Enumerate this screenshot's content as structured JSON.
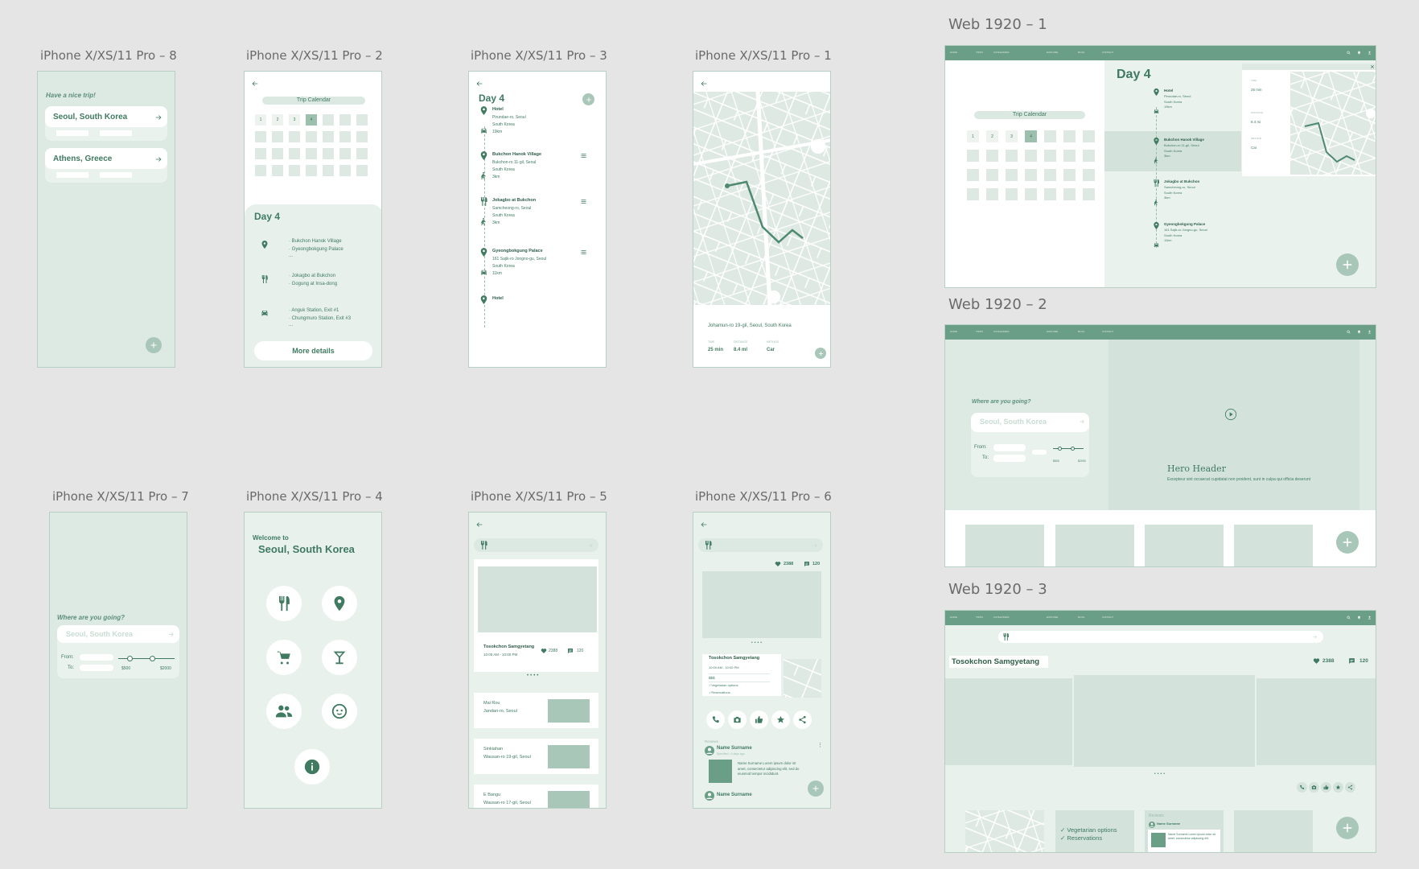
{
  "frames": {
    "f8": "iPhone X/XS/11 Pro – 8",
    "f2": "iPhone X/XS/11 Pro – 2",
    "f3": "iPhone X/XS/11 Pro – 3",
    "f1": "iPhone X/XS/11 Pro – 1",
    "f7": "iPhone X/XS/11 Pro – 7",
    "f4": "iPhone X/XS/11 Pro – 4",
    "f5": "iPhone X/XS/11 Pro – 5",
    "f6": "iPhone X/XS/11 Pro – 6",
    "w1": "Web 1920 – 1",
    "w2": "Web 1920 – 2",
    "w3": "Web 1920 – 3"
  },
  "icons": {
    "back": "arrow-left-icon",
    "add": "plus-icon",
    "pin": "map-pin-icon",
    "food": "fork-knife-icon",
    "car": "car-icon",
    "walk": "walking-icon",
    "menu": "hamburger-icon",
    "cart": "shopping-cart-icon",
    "drink": "cocktail-icon",
    "people": "people-icon",
    "baby": "baby-face-icon",
    "info": "info-icon",
    "heart": "heart-icon",
    "comment": "comment-icon",
    "phone": "phone-icon",
    "camera": "camera-icon",
    "like": "thumbs-up-icon",
    "star": "star-icon",
    "share": "share-icon",
    "play": "play-icon",
    "search": "search-icon",
    "bell": "bell-icon",
    "user": "user-icon",
    "close": "close-icon",
    "avatar": "avatar-icon"
  },
  "colors": {
    "brand": "#6a9e86",
    "mint": "#dde9e3",
    "accent": "#3f7a61"
  },
  "s8": {
    "greeting": "Have a nice trip!",
    "trips": [
      "Seoul, South Korea",
      "Athens, Greece"
    ]
  },
  "s2": {
    "calendar_title": "Trip Calendar",
    "days": [
      "1",
      "2",
      "3",
      "4"
    ],
    "day": "Day 4",
    "groups": [
      [
        "· Bukchon Hanok Village",
        "· Gyeongbokgung Palace",
        "..."
      ],
      [
        "· Jokagbo at Bukchon",
        "· Gogung at Insa-dong"
      ],
      [
        "· Anguk Station, Exit #1",
        "· Chungmuro Station, Exit #3",
        "..."
      ]
    ],
    "more": "More details"
  },
  "s3": {
    "day": "Day 4",
    "stops": [
      {
        "name": "Hotel",
        "lines": [
          "Pirundae-ro, Seoul",
          "South Korea",
          "19km"
        ]
      },
      {
        "name": "Bukchon Hanok Village",
        "lines": [
          "Bukchon-ro 11-gil, Seoul",
          "South Korea",
          "3km"
        ]
      },
      {
        "name": "Jokagbo at Bukchon",
        "lines": [
          "Samcheong-ro, Seoul",
          "South Korea",
          "3km"
        ]
      },
      {
        "name": "Gyeongbokgung Palace",
        "lines": [
          "161 Sajik-ro Jongno-gu, Seoul",
          "South Korea",
          "11km"
        ]
      },
      {
        "name": "Hotel",
        "lines": []
      }
    ]
  },
  "s1": {
    "address": "Johamun-ro 19-gil, Seoul, South Korea",
    "stats": [
      {
        "label": "TIME",
        "value": "25 min"
      },
      {
        "label": "DISTANCE",
        "value": "8.4 ml"
      },
      {
        "label": "METHOD",
        "value": "Car"
      }
    ]
  },
  "s7": {
    "question": "Where are you going?",
    "placeholder": "Seoul, South Korea",
    "from": "From:",
    "to": "To:",
    "price_min": "$500",
    "price_max": "$2000",
    "range_low": 0.2,
    "range_high": 0.6
  },
  "s4": {
    "welcome": "Welcome to",
    "city": "Seoul, South Korea"
  },
  "s5": {
    "place": "Tosokchon Samgyetang",
    "hours": "10:00 AM - 10:00 PM",
    "likes": "2388",
    "comments": "120",
    "list": [
      {
        "name": "Mai Rou",
        "addr": "Jandari-ro, Seoul"
      },
      {
        "name": "Sinkiahan",
        "addr": "Wausan-ro 19-gil, Seoul"
      },
      {
        "name": "E Bangu",
        "addr": "Wausan-ro 17-gil, Seoul"
      }
    ]
  },
  "s6": {
    "likes": "2388",
    "comments": "120",
    "place": "Tosokchon Samgyetang",
    "hours": "10:00 AM - 10:00 PM",
    "price": "$$$",
    "features": [
      "✓Vegetarian options",
      "✓Reservations"
    ],
    "reviews_label": "Reviews",
    "reviewer": "Name Surname",
    "review_sub": "Specified • 4 days ago",
    "review_text": "Name Surname Lorem ipsum dolor sit amet, consectetur adipiscing elit, sed do eiusmod tempor incididunt.",
    "reviewer2": "Name Surname"
  },
  "w1": {
    "nav": [
      "HOME",
      "TRIPS",
      "CATEGORIES",
      "EXPLORE",
      "BLOG",
      "CONTACT"
    ],
    "calendar_title": "Trip Calendar",
    "days": [
      "1",
      "2",
      "3",
      "4"
    ],
    "day": "Day 4",
    "stops": [
      {
        "name": "Hotel",
        "lines": [
          "Pirundae-ro, Seoul",
          "South Korea",
          "19km"
        ]
      },
      {
        "name": "Bukchon Hanok Village",
        "lines": [
          "Bukchon-ro 11-gil, Seoul",
          "South Korea",
          "3km"
        ]
      },
      {
        "name": "Jokagbo at Bukchon",
        "lines": [
          "Samcheong-ro, Seoul",
          "South Korea",
          "3km"
        ]
      },
      {
        "name": "Gyeongbokgung Palace",
        "lines": [
          "161 Sajik-ro Jongno-gu, Seoul",
          "South Korea",
          "11km"
        ]
      }
    ],
    "stats": [
      {
        "label": "TIME",
        "value": "25 min"
      },
      {
        "label": "DISTANCE",
        "value": "8.4 mi"
      },
      {
        "label": "METHOD",
        "value": "Car"
      }
    ]
  },
  "w2": {
    "question": "Where are you going?",
    "placeholder": "Seoul, South Korea",
    "from": "From:",
    "to": "To:",
    "price_min": "$500",
    "price_max": "$2000",
    "hero_title": "Hero Header",
    "hero_text": "Excepteur sint occaecat cupidatat non proident, sunt in culpa qui officia deserunt"
  },
  "w3": {
    "place": "Tosokchon Samgyetang",
    "likes": "2388",
    "comments": "120",
    "features": [
      "✓ Vegetarian options",
      "✓ Reservations"
    ],
    "reviews_label": "Reviews",
    "reviewer": "Name Surname",
    "review_text": "Name Surname Lorem ipsum dolor sit amet, consectetur adipiscing elit."
  }
}
